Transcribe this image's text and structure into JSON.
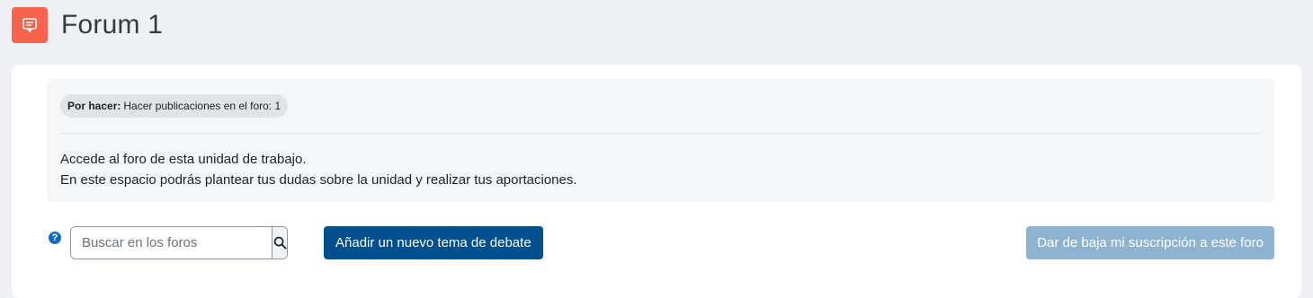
{
  "header": {
    "icon": "forum-icon",
    "title": "Forum 1"
  },
  "activity": {
    "badge_label": "Por hacer:",
    "badge_text": "Hacer publicaciones en el foro: 1",
    "description_lines": [
      "Accede al foro de esta unidad de trabajo.",
      "En este espacio podrás plantear tus dudas sobre la unidad y realizar tus aportaciones."
    ]
  },
  "toolbar": {
    "help_icon": "question-circle-icon",
    "search_placeholder": "Buscar en los foros",
    "search_value": "",
    "search_icon": "search-icon",
    "add_topic_label": "Añadir un nuevo tema de debate",
    "unsubscribe_label": "Dar de baja mi suscripción a este foro"
  },
  "colors": {
    "accent": "#f7634d",
    "primary": "#004f8f",
    "disabled_button": "#8db3d1",
    "page_background": "#eef0f3"
  }
}
